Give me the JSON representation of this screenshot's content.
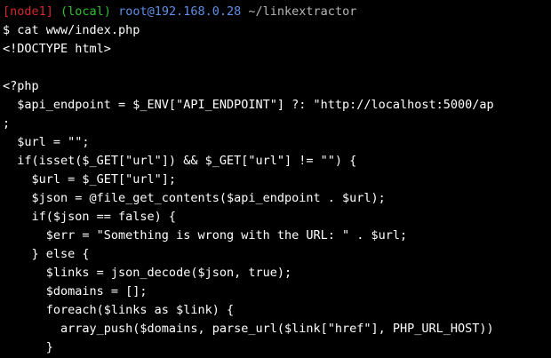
{
  "colors": {
    "background": "#000000",
    "text": "#ffffff",
    "node_tag": "#d4282d",
    "local_tag": "#30c030",
    "user_host": "#5f8fe6",
    "cwd": "#b5b5b5"
  },
  "prompt": {
    "node": "[node1]",
    "local": "(local)",
    "user_host": "root@192.168.0.28",
    "cwd": "~/linkextractor"
  },
  "command": "$ cat www/index.php",
  "output": [
    "<!DOCTYPE html>",
    "",
    "<?php",
    "  $api_endpoint = $_ENV[\"API_ENDPOINT\"] ?: \"http://localhost:5000/ap",
    ";",
    "  $url = \"\";",
    "  if(isset($_GET[\"url\"]) && $_GET[\"url\"] != \"\") {",
    "    $url = $_GET[\"url\"];",
    "    $json = @file_get_contents($api_endpoint . $url);",
    "    if($json == false) {",
    "      $err = \"Something is wrong with the URL: \" . $url;",
    "    } else {",
    "      $links = json_decode($json, true);",
    "      $domains = [];",
    "      foreach($links as $link) {",
    "        array_push($domains, parse_url($link[\"href\"], PHP_URL_HOST))",
    "      }"
  ]
}
